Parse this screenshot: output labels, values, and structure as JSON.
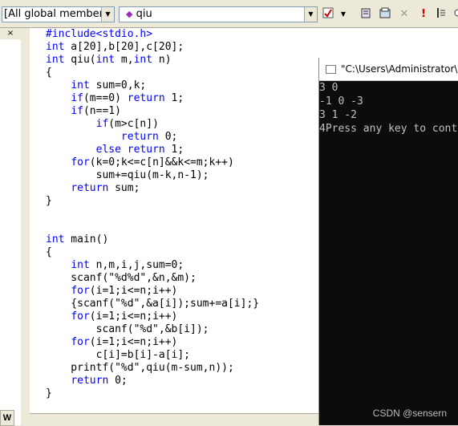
{
  "toolbar": {
    "scope_combo": "[All global members",
    "function_combo": "qiu"
  },
  "left_pane": {
    "close_glyph": "×",
    "tab_label": "W"
  },
  "code_lines": [
    [
      {
        "t": "#include<stdio.h>",
        "kw": true
      }
    ],
    [
      {
        "t": "int",
        "kw": true
      },
      {
        "t": " a[20],b[20],c[20];"
      }
    ],
    [
      {
        "t": "int",
        "kw": true
      },
      {
        "t": " qiu("
      },
      {
        "t": "int",
        "kw": true
      },
      {
        "t": " m,"
      },
      {
        "t": "int",
        "kw": true
      },
      {
        "t": " n)"
      }
    ],
    [
      {
        "t": "{"
      }
    ],
    [
      {
        "t": "    "
      },
      {
        "t": "int",
        "kw": true
      },
      {
        "t": " sum=0,k;"
      }
    ],
    [
      {
        "t": "    "
      },
      {
        "t": "if",
        "kw": true
      },
      {
        "t": "(m==0) "
      },
      {
        "t": "return",
        "kw": true
      },
      {
        "t": " 1;"
      }
    ],
    [
      {
        "t": "    "
      },
      {
        "t": "if",
        "kw": true
      },
      {
        "t": "(n==1)"
      }
    ],
    [
      {
        "t": "        "
      },
      {
        "t": "if",
        "kw": true
      },
      {
        "t": "(m>c[n])"
      }
    ],
    [
      {
        "t": "            "
      },
      {
        "t": "return",
        "kw": true
      },
      {
        "t": " 0;"
      }
    ],
    [
      {
        "t": "        "
      },
      {
        "t": "else",
        "kw": true
      },
      {
        "t": " "
      },
      {
        "t": "return",
        "kw": true
      },
      {
        "t": " 1;"
      }
    ],
    [
      {
        "t": "    "
      },
      {
        "t": "for",
        "kw": true
      },
      {
        "t": "(k=0;k<=c[n]&&k<=m;k++)"
      }
    ],
    [
      {
        "t": "        sum+=qiu(m-k,n-1);"
      }
    ],
    [
      {
        "t": "    "
      },
      {
        "t": "return",
        "kw": true
      },
      {
        "t": " sum;"
      }
    ],
    [
      {
        "t": "}"
      }
    ],
    [
      {
        "t": ""
      }
    ],
    [
      {
        "t": ""
      }
    ],
    [
      {
        "t": "int",
        "kw": true
      },
      {
        "t": " main()"
      }
    ],
    [
      {
        "t": "{"
      }
    ],
    [
      {
        "t": "    "
      },
      {
        "t": "int",
        "kw": true
      },
      {
        "t": " n,m,i,j,sum=0;"
      }
    ],
    [
      {
        "t": "    scanf(\"%d%d\",&n,&m);"
      }
    ],
    [
      {
        "t": "    "
      },
      {
        "t": "for",
        "kw": true
      },
      {
        "t": "(i=1;i<=n;i++)"
      }
    ],
    [
      {
        "t": "    {scanf(\"%d\",&a[i]);sum+=a[i];}"
      }
    ],
    [
      {
        "t": "    "
      },
      {
        "t": "for",
        "kw": true
      },
      {
        "t": "(i=1;i<=n;i++)"
      }
    ],
    [
      {
        "t": "        scanf(\"%d\",&b[i]);"
      }
    ],
    [
      {
        "t": "    "
      },
      {
        "t": "for",
        "kw": true
      },
      {
        "t": "(i=1;i<=n;i++)"
      }
    ],
    [
      {
        "t": "        c[i]=b[i]-a[i];"
      }
    ],
    [
      {
        "t": "    printf(\"%d\",qiu(m-sum,n));"
      }
    ],
    [
      {
        "t": "    "
      },
      {
        "t": "return",
        "kw": true
      },
      {
        "t": " 0;"
      }
    ],
    [
      {
        "t": "}"
      }
    ]
  ],
  "console": {
    "title": "\"C:\\Users\\Administrator\\",
    "output_lines": [
      "3 0",
      "-1 0 -3",
      "3 1 -2",
      "4Press any key to cont"
    ]
  },
  "watermark": "CSDN @sensern",
  "colors": {
    "keyword": "#0000ff",
    "console_bg": "#0c0c0c",
    "console_text": "#c0c0c0"
  }
}
